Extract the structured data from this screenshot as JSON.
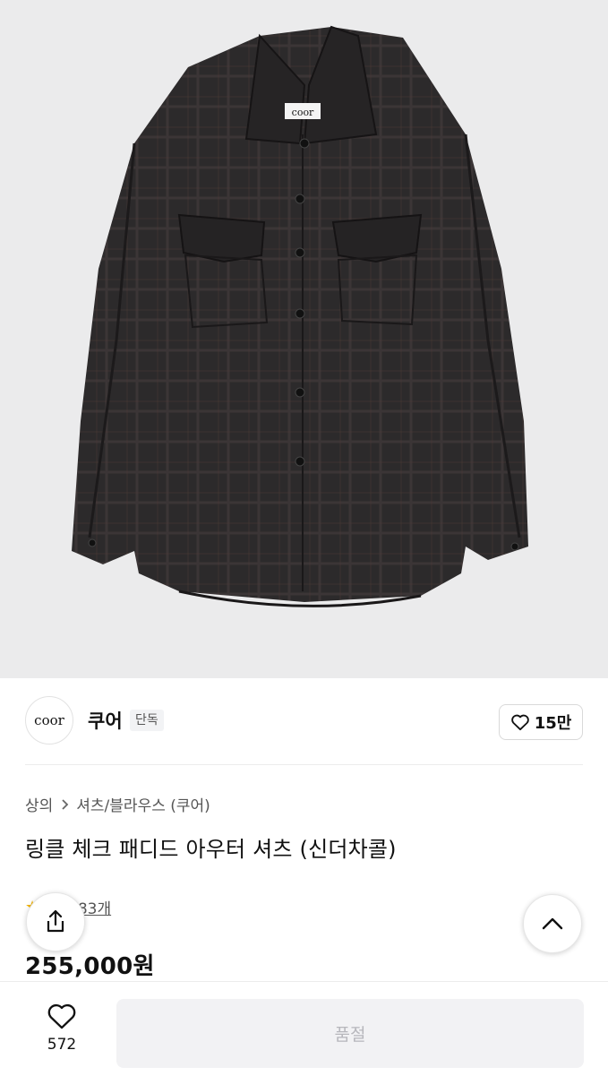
{
  "product_image": {
    "alt": "쿠어 셔츠 상품 이미지",
    "label_text": "coor"
  },
  "brand": {
    "logo_text": "coor",
    "name": "쿠어",
    "badge": "단독",
    "likes_label": "15만"
  },
  "breadcrumb": {
    "items": [
      "상의",
      "셔츠/블라우스 (쿠어)"
    ]
  },
  "product": {
    "title": "링클 체크 패디드 아우터 셔츠 (신더차콜)",
    "review_label": "후기 83개",
    "price": "255,000원"
  },
  "actions": {
    "share_icon": "share-icon",
    "scroll_top_icon": "chevron-up-icon"
  },
  "bottom_bar": {
    "wish_count": "572",
    "buy_label": "품절"
  },
  "colors": {
    "accent_star": "#f3b300",
    "disabled_bg": "#f2f2f4",
    "disabled_text": "#b7b7bc"
  }
}
